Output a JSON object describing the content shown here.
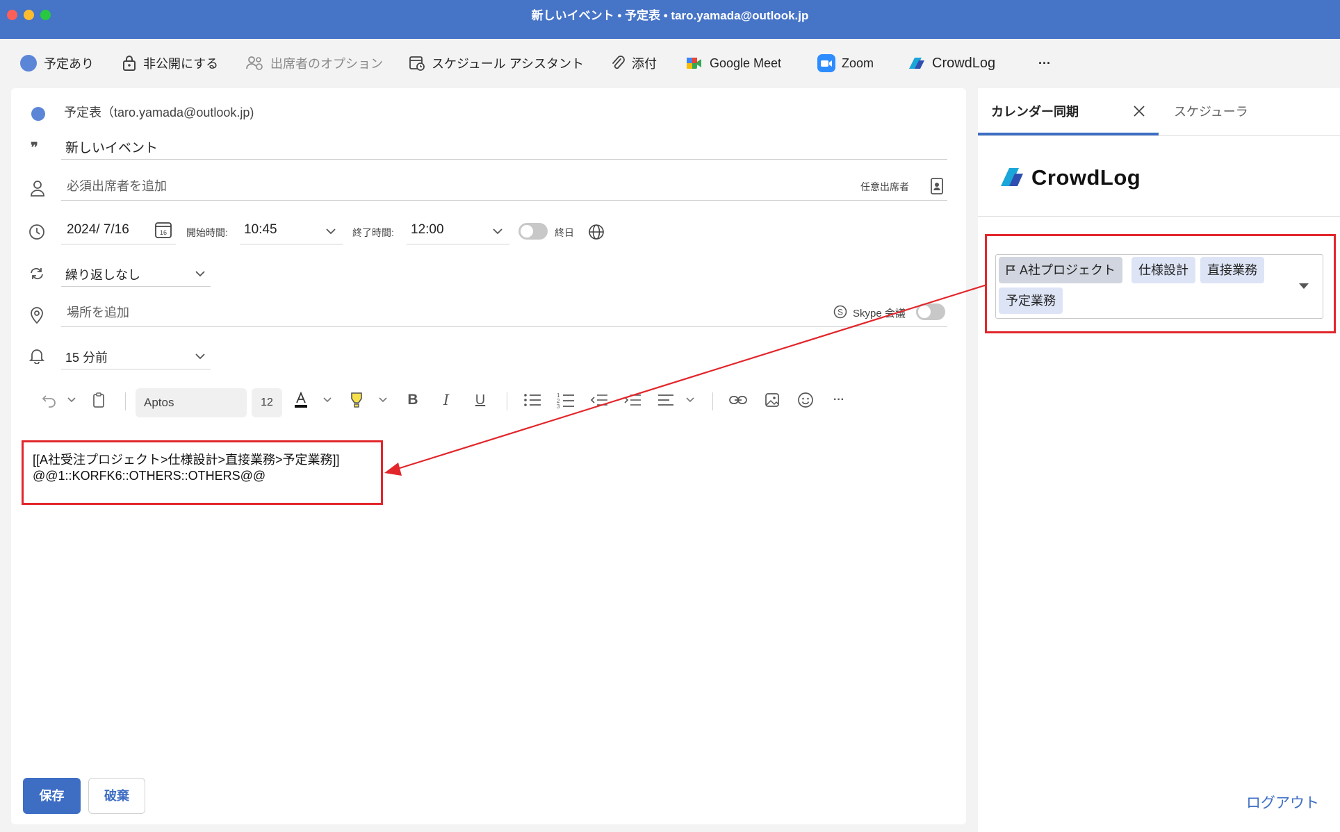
{
  "window": {
    "title": "新しいイベント • 予定表 • taro.yamada@outlook.jp",
    "traffic_colors": [
      "#ff5f57",
      "#febc2e",
      "#28c840"
    ]
  },
  "ribbon": {
    "busy": "予定あり",
    "private": "非公開にする",
    "attendee_options": "出席者のオプション",
    "schedule_assistant": "スケジュール アシスタント",
    "attach": "添付",
    "google_meet": "Google Meet",
    "zoom": "Zoom",
    "crowdlog": "CrowdLog",
    "more": "···"
  },
  "event": {
    "calendar": "予定表（taro.yamada@outlook.jp)",
    "title": "新しいイベント",
    "attendees_placeholder": "必須出席者を追加",
    "optional_attendees": "任意出席者",
    "date": "2024/ 7/16",
    "calendar_icon_day": "16",
    "start_label": "開始時間:",
    "start_time": "10:45",
    "end_label": "終了時間:",
    "end_time": "12:00",
    "all_day": "終日",
    "repeat": "繰り返しなし",
    "location_placeholder": "場所を追加",
    "skype": "Skype 会議",
    "reminder": "15 分前"
  },
  "format_toolbar": {
    "font": "Aptos",
    "size": "12",
    "more": "···"
  },
  "body": {
    "line1": "[[A社受注プロジェクト>仕様設計>直接業務>予定業務]]",
    "line2": "@@1::KORFK6::OTHERS::OTHERS@@"
  },
  "actions": {
    "save": "保存",
    "discard": "破棄"
  },
  "side_pane": {
    "tab_active": "カレンダー同期",
    "tab_inactive": "スケジューラ",
    "logo_text": "CrowdLog",
    "chips": [
      "A社プロジェクト",
      "仕様設計",
      "直接業務",
      "予定業務"
    ],
    "logout": "ログアウト"
  },
  "colors": {
    "accent": "#3e6ec4",
    "titlebar": "#4674c7",
    "highlight_red": "#e2262b"
  }
}
